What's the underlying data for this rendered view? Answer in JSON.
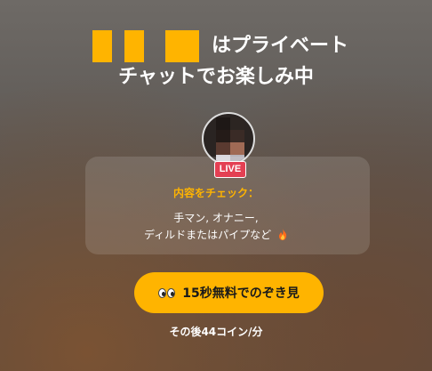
{
  "header": {
    "line1_suffix": "はプライベート",
    "line2": "チャットでお楽しみ中"
  },
  "avatar": {
    "badge": "LIVE"
  },
  "content_card": {
    "heading": "内容をチェック：",
    "line1": "手マン, オナニー,",
    "line2": "ディルドまたはパイプなど",
    "icon": "fire-icon"
  },
  "cta": {
    "label": "15秒無料でのぞき見",
    "icon": "eyes-icon"
  },
  "price_note": "その後44コイン/分",
  "colors": {
    "accent": "#ffb400",
    "live": "#e0243a"
  }
}
